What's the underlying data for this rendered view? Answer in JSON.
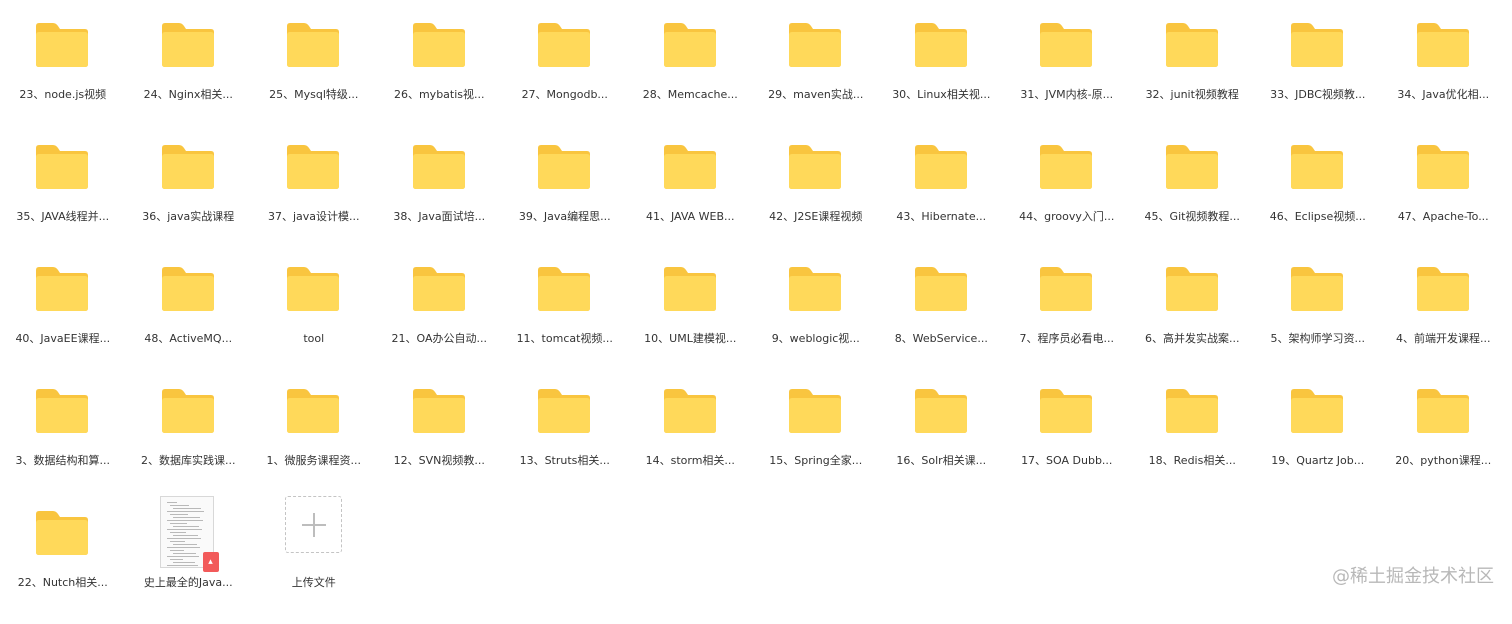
{
  "colors": {
    "folder_back": "#f9c53f",
    "folder_front": "#ffd95a",
    "label_text": "#333333",
    "pdf_badge": "#f25a5a",
    "watermark": "#b8b8b8"
  },
  "items": [
    {
      "label": "23、node.js视频",
      "type": "folder"
    },
    {
      "label": "24、Nginx相关...",
      "type": "folder"
    },
    {
      "label": "25、Mysql特级...",
      "type": "folder"
    },
    {
      "label": "26、mybatis视...",
      "type": "folder"
    },
    {
      "label": "27、Mongodb...",
      "type": "folder"
    },
    {
      "label": "28、Memcache...",
      "type": "folder"
    },
    {
      "label": "29、maven实战...",
      "type": "folder"
    },
    {
      "label": "30、Linux相关视...",
      "type": "folder"
    },
    {
      "label": "31、JVM内核-原...",
      "type": "folder"
    },
    {
      "label": "32、junit视频教程",
      "type": "folder"
    },
    {
      "label": "33、JDBC视频教...",
      "type": "folder"
    },
    {
      "label": "34、Java优化相...",
      "type": "folder"
    },
    {
      "label": "35、JAVA线程并...",
      "type": "folder"
    },
    {
      "label": "36、java实战课程",
      "type": "folder"
    },
    {
      "label": "37、java设计模...",
      "type": "folder"
    },
    {
      "label": "38、Java面试培...",
      "type": "folder"
    },
    {
      "label": "39、Java编程思...",
      "type": "folder"
    },
    {
      "label": "41、JAVA WEB...",
      "type": "folder"
    },
    {
      "label": "42、J2SE课程视频",
      "type": "folder"
    },
    {
      "label": "43、Hibernate...",
      "type": "folder"
    },
    {
      "label": "44、groovy入门...",
      "type": "folder"
    },
    {
      "label": "45、Git视频教程...",
      "type": "folder"
    },
    {
      "label": "46、Eclipse视频...",
      "type": "folder"
    },
    {
      "label": "47、Apache-To...",
      "type": "folder"
    },
    {
      "label": "40、JavaEE课程...",
      "type": "folder"
    },
    {
      "label": "48、ActiveMQ...",
      "type": "folder"
    },
    {
      "label": "tool",
      "type": "folder"
    },
    {
      "label": "21、OA办公自动...",
      "type": "folder"
    },
    {
      "label": "11、tomcat视频...",
      "type": "folder"
    },
    {
      "label": "10、UML建模视...",
      "type": "folder"
    },
    {
      "label": "9、weblogic视...",
      "type": "folder"
    },
    {
      "label": "8、WebService...",
      "type": "folder"
    },
    {
      "label": "7、程序员必看电...",
      "type": "folder"
    },
    {
      "label": "6、高并发实战案...",
      "type": "folder"
    },
    {
      "label": "5、架构师学习资...",
      "type": "folder"
    },
    {
      "label": "4、前端开发课程...",
      "type": "folder"
    },
    {
      "label": "3、数据结构和算...",
      "type": "folder"
    },
    {
      "label": "2、数据库实践课...",
      "type": "folder"
    },
    {
      "label": "1、微服务课程资...",
      "type": "folder"
    },
    {
      "label": "12、SVN视频教...",
      "type": "folder"
    },
    {
      "label": "13、Struts相关...",
      "type": "folder"
    },
    {
      "label": "14、storm相关...",
      "type": "folder"
    },
    {
      "label": "15、Spring全家...",
      "type": "folder"
    },
    {
      "label": "16、Solr相关课...",
      "type": "folder"
    },
    {
      "label": "17、SOA Dubb...",
      "type": "folder"
    },
    {
      "label": "18、Redis相关...",
      "type": "folder"
    },
    {
      "label": "19、Quartz Job...",
      "type": "folder"
    },
    {
      "label": "20、python课程...",
      "type": "folder"
    },
    {
      "label": "22、Nutch相关...",
      "type": "folder"
    },
    {
      "label": "史上最全的Java...",
      "type": "pdf"
    },
    {
      "label": "上传文件",
      "type": "upload"
    }
  ],
  "watermark": "@稀土掘金技术社区"
}
